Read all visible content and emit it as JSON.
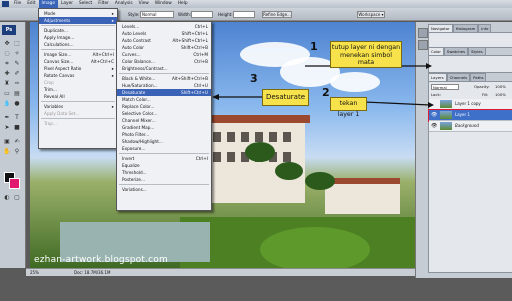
{
  "menubar": {
    "items": [
      "File",
      "Edit",
      "Image",
      "Layer",
      "Select",
      "Filter",
      "Analysis",
      "View",
      "Window",
      "Help"
    ]
  },
  "options_bar": {
    "style_label": "Style:",
    "style_value": "Normal",
    "width_label": "Width:",
    "height_label": "Height:",
    "refine_label": "Refine Edge...",
    "workspace_label": "Workspace ▾"
  },
  "image_menu": {
    "items": [
      {
        "label": "Mode",
        "submenu": true
      },
      {
        "label": "Adjustments",
        "submenu": true,
        "highlighted": true
      },
      {
        "separator": true
      },
      {
        "label": "Duplicate..."
      },
      {
        "label": "Apply Image..."
      },
      {
        "label": "Calculations..."
      },
      {
        "separator": true
      },
      {
        "label": "Image Size...",
        "shortcut": "Alt+Ctrl+I"
      },
      {
        "label": "Canvas Size...",
        "shortcut": "Alt+Ctrl+C"
      },
      {
        "label": "Pixel Aspect Ratio",
        "submenu": true
      },
      {
        "label": "Rotate Canvas",
        "submenu": true
      },
      {
        "label": "Crop",
        "disabled": true
      },
      {
        "label": "Trim..."
      },
      {
        "label": "Reveal All"
      },
      {
        "separator": true
      },
      {
        "label": "Variables",
        "submenu": true
      },
      {
        "label": "Apply Data Set...",
        "disabled": true
      },
      {
        "separator": true
      },
      {
        "label": "Trap...",
        "disabled": true
      }
    ]
  },
  "adjustments_menu": {
    "items": [
      {
        "label": "Levels...",
        "shortcut": "Ctrl+L"
      },
      {
        "label": "Auto Levels",
        "shortcut": "Shift+Ctrl+L"
      },
      {
        "label": "Auto Contrast",
        "shortcut": "Alt+Shift+Ctrl+L"
      },
      {
        "label": "Auto Color",
        "shortcut": "Shift+Ctrl+B"
      },
      {
        "label": "Curves...",
        "shortcut": "Ctrl+M"
      },
      {
        "label": "Color Balance...",
        "shortcut": "Ctrl+B"
      },
      {
        "label": "Brightness/Contrast..."
      },
      {
        "separator": true
      },
      {
        "label": "Black & White...",
        "shortcut": "Alt+Shift+Ctrl+B"
      },
      {
        "label": "Hue/Saturation...",
        "shortcut": "Ctrl+U"
      },
      {
        "label": "Desaturate",
        "shortcut": "Shift+Ctrl+U",
        "highlighted": true
      },
      {
        "label": "Match Color..."
      },
      {
        "label": "Replace Color..."
      },
      {
        "label": "Selective Color..."
      },
      {
        "label": "Channel Mixer..."
      },
      {
        "label": "Gradient Map..."
      },
      {
        "label": "Photo Filter..."
      },
      {
        "label": "Shadow/Highlight..."
      },
      {
        "label": "Exposure..."
      },
      {
        "separator": true
      },
      {
        "label": "Invert",
        "shortcut": "Ctrl+I"
      },
      {
        "label": "Equalize"
      },
      {
        "label": "Threshold..."
      },
      {
        "label": "Posterize..."
      },
      {
        "separator": true
      },
      {
        "label": "Variations..."
      }
    ]
  },
  "panels": {
    "top_tabs": [
      "Navigator",
      "Histogram",
      "Info"
    ],
    "color_tabs": [
      "Color",
      "Swatches",
      "Styles"
    ],
    "layers_tabs": [
      "Layers",
      "Channels",
      "Paths"
    ],
    "blend_mode": "Normal",
    "opacity_label": "Opacity:",
    "opacity_value": "100%",
    "fill_label": "Fill:",
    "fill_value": "100%",
    "lock_label": "Lock:",
    "layers": [
      {
        "name": "Layer 1 copy",
        "selected": false
      },
      {
        "name": "Layer 1",
        "selected": true
      },
      {
        "name": "Background",
        "selected": false
      }
    ]
  },
  "status": {
    "zoom": "25%",
    "doc": "Doc: 18.7M/36.1M"
  },
  "annotations": {
    "step1_number": "1",
    "step1_text": "tutup layer ni dengan menekan simbol mata",
    "step2_number": "2",
    "step2_text": "tekan layer 1",
    "step3_number": "3",
    "step3_text": "Desaturate",
    "watermark": "ezhan-artwork.blogspot.com",
    "note_color": "#f7e24b",
    "highlight_color": "#e01830"
  }
}
